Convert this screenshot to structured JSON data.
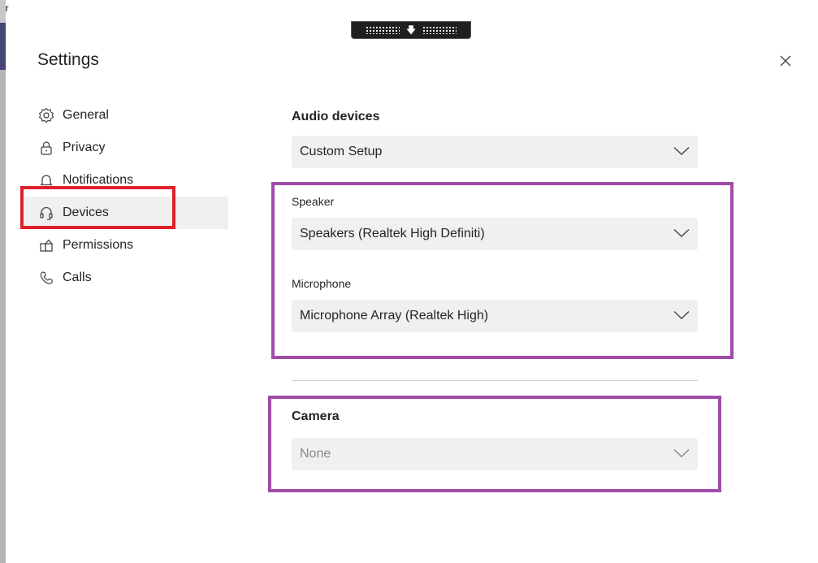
{
  "background": {
    "corner_text": "er"
  },
  "dialog": {
    "title": "Settings",
    "close_icon": "close-icon"
  },
  "sidebar": {
    "items": [
      {
        "label": "General",
        "icon": "gear-icon",
        "active": false
      },
      {
        "label": "Privacy",
        "icon": "lock-icon",
        "active": false
      },
      {
        "label": "Notifications",
        "icon": "bell-icon",
        "active": false
      },
      {
        "label": "Devices",
        "icon": "headset-icon",
        "active": true
      },
      {
        "label": "Permissions",
        "icon": "permissions-icon",
        "active": false
      },
      {
        "label": "Calls",
        "icon": "phone-icon",
        "active": false
      }
    ]
  },
  "main": {
    "audio_devices": {
      "heading": "Audio devices",
      "value": "Custom Setup"
    },
    "speaker": {
      "label": "Speaker",
      "value": "Speakers (Realtek High Definiti)"
    },
    "microphone": {
      "label": "Microphone",
      "value": "Microphone Array (Realtek High)"
    },
    "camera": {
      "heading": "Camera",
      "value": "None"
    }
  },
  "colors": {
    "highlight_red": "#e0202a",
    "highlight_purple": "#a04ca8",
    "dropdown_bg": "#f1f0ef",
    "active_nav_bg": "#f0f0f0"
  }
}
